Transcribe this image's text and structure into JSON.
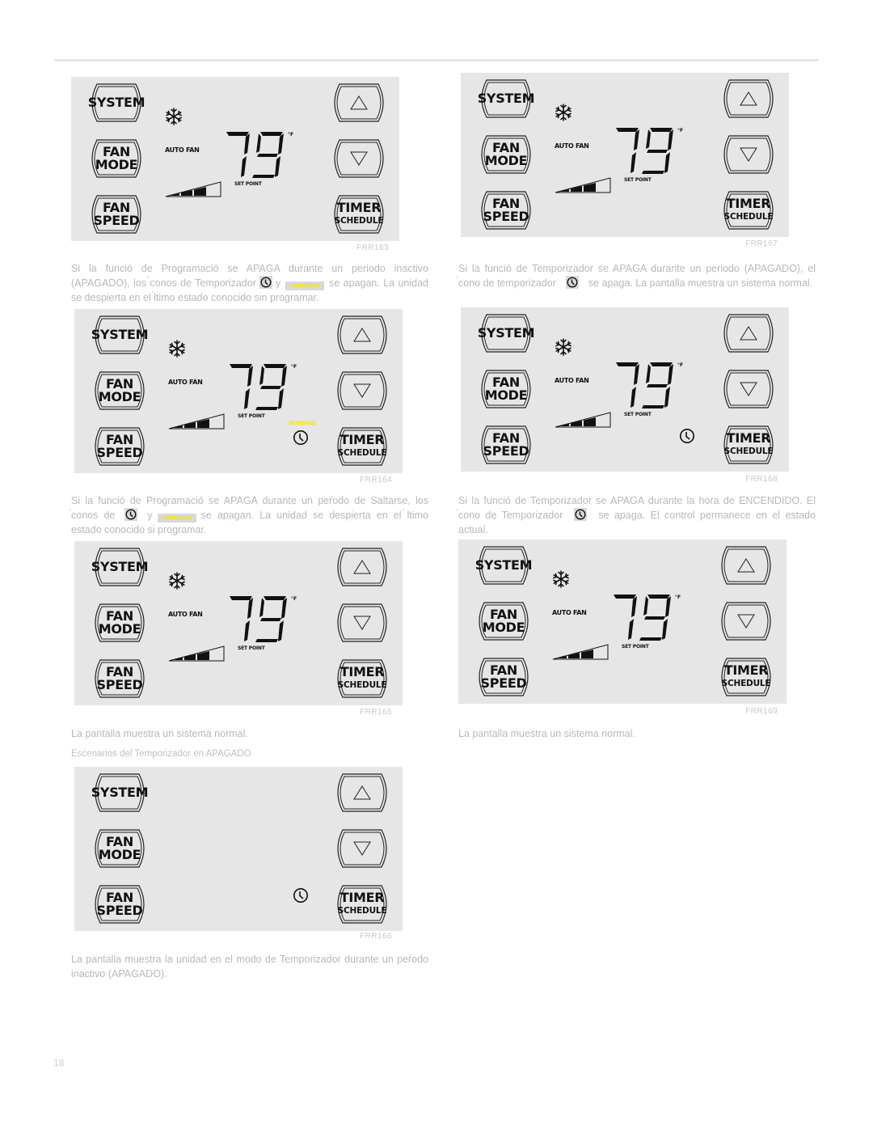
{
  "page": {
    "page_number": "18",
    "section_title": "Escenarios del Temporizador en APAGADO"
  },
  "panel_labels": {
    "system": "SYSTEM",
    "fan": "FAN",
    "mode": "MODE",
    "speed": "SPEED",
    "timer": "TIMER",
    "schedule": "SCHEDULE",
    "auto_fan": "AUTO FAN",
    "set_point": "SET POINT",
    "temperature": "79",
    "unit": "°F",
    "schedule_indicator": "SCHEDULE"
  },
  "figures": [
    {
      "code": "FRR163",
      "display_on": true,
      "fan_speed_level": "3 of 4",
      "schedule_indicator": false,
      "timer_clock": false
    },
    {
      "code": "FRR167",
      "display_on": true,
      "fan_speed_level": "3 of 4",
      "schedule_indicator": false,
      "timer_clock": false
    },
    {
      "code": "FRR164",
      "display_on": true,
      "fan_speed_level": "3 of 4",
      "schedule_indicator": true,
      "timer_clock": true
    },
    {
      "code": "FRR168",
      "display_on": true,
      "fan_speed_level": "3 of 4",
      "schedule_indicator": false,
      "timer_clock": true
    },
    {
      "code": "FRR165",
      "display_on": true,
      "fan_speed_level": "3 of 4",
      "schedule_indicator": false,
      "timer_clock": false
    },
    {
      "code": "FRR169",
      "display_on": true,
      "fan_speed_level": "3 of 4",
      "schedule_indicator": false,
      "timer_clock": false
    },
    {
      "code": "FRR166",
      "display_on": false,
      "schedule_indicator": false,
      "timer_clock": true
    }
  ],
  "captions": {
    "c1": {
      "a": "Si la funció de Programació se APAGA durante un periodo inactivo (APAGADO), los ́conos de Temporizador",
      "b": "y",
      "c": "se apagan. La unidad se despierta en el ́ltimo estado conocido sin programar."
    },
    "c2": {
      "a": "Si la funció de Temporizador se APAGA durante un periodo (APAGADO), el ́cono de temporizador",
      "b": "se apaga. La pantalla muestra un sistema normal."
    },
    "c3": {
      "a": "Si la funció de Programació se APAGA durante un peŕodo de Saltarse, los ́conos de",
      "b": "y",
      "c": "se apagan. La unidad se despierta en el ́ltimo estado conocido si programar."
    },
    "c4": {
      "a": "Si la funció de Temporizador se APAGA durante la hora de ENCENDIDO. El ́cono de Temporizador",
      "b": "se apaga. El control permanece en el estado actual."
    },
    "c5": "La pantalla muestra un sistema normal.",
    "c6": "La pantalla muestra un sistema normal.",
    "c7": "La pantalla muestra la unidad en el modo de Temporizador durante un peŕodo inactivo (APAGADO)."
  },
  "colors": {
    "panel_bg": "#e6e6e6",
    "schedule_yellow": "#f2e600",
    "caption_gray": "#b8b8b8"
  }
}
